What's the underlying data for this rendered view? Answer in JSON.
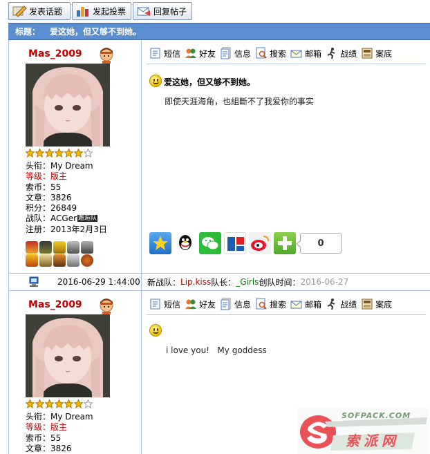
{
  "toolbar": {
    "new_topic": "发表话题",
    "new_poll": "发起投票",
    "reply": "回复帖子"
  },
  "thread": {
    "label": "标题：",
    "title": "爱这她，但又够不到她。"
  },
  "actions": [
    "短信",
    "好友",
    "信息",
    "搜索",
    "邮箱",
    "战绩",
    "案底"
  ],
  "posts": [
    {
      "username": "Mas_2009",
      "stars": 7,
      "info": {
        "title_label": "头衔：",
        "title_value": "My Dream",
        "level_label": "等级：",
        "level_value": "版主",
        "coins_label": "索币：",
        "coins_value": "55",
        "articles_label": "文章：",
        "articles_value": "3826",
        "points_label": "积分：",
        "points_value": "26849",
        "team_label": "战队：",
        "team_value": "ACGer",
        "team_badge": "邂逅队",
        "reg_label": "注册：",
        "reg_value": "2013年2月3日"
      },
      "post_title": "爱这她，但又够不到她。",
      "body": "即使天涯海角，也組斷不了我爱你的事实",
      "share_count": "0"
    },
    {
      "username": "Mas_2009",
      "stars": 7,
      "info": {
        "title_label": "头衔：",
        "title_value": "My Dream",
        "level_label": "等级：",
        "level_value": "版主",
        "coins_label": "索币：",
        "coins_value": "55",
        "articles_label": "文章：",
        "articles_value": "3826"
      },
      "body": "i love you!   My goddess"
    }
  ],
  "footer": {
    "datetime": "2016-06-29 1:44:00",
    "team_prefix": "新战队：",
    "team_name": "Lip.kiss",
    "leader_label": " 队长：",
    "leader_name": "_Girls",
    "created_label": " 创队时间：",
    "created_date": "2016-06-27"
  },
  "watermark": {
    "url": "SOFPACK.COM",
    "name": "索派网"
  },
  "colors": {
    "title_bar": "#5b8ed0",
    "username": "#c00000",
    "level": "#c00000",
    "team_name": "#c00000",
    "leader_name": "#008000"
  }
}
